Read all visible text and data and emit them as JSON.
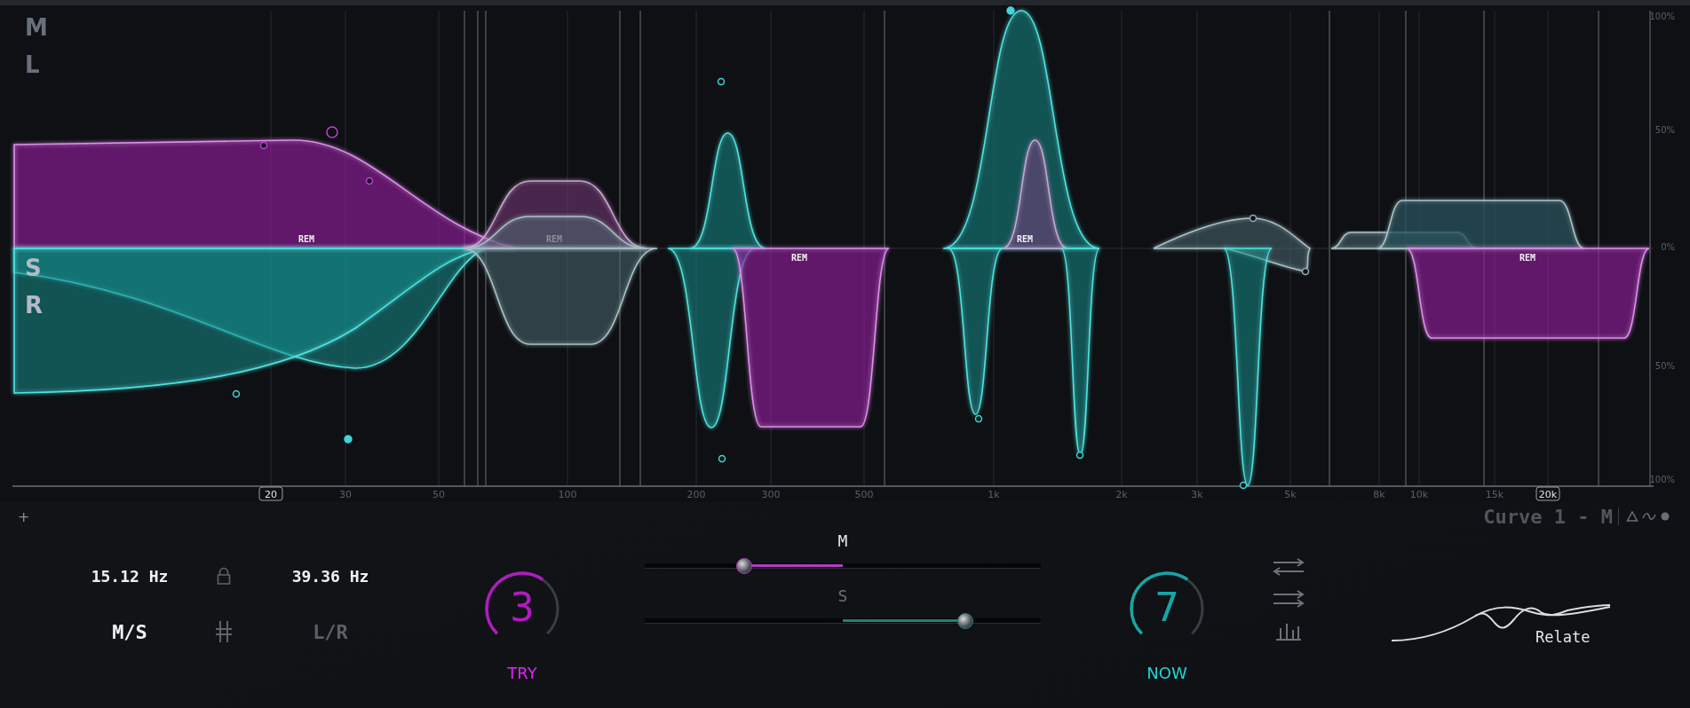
{
  "channel_labels": {
    "top": [
      "M",
      "L"
    ],
    "bottom": [
      "S",
      "R"
    ]
  },
  "band_labels": [
    {
      "text": "REM",
      "dimmed": false
    },
    {
      "text": "REM",
      "dimmed": true
    },
    {
      "text": "REM",
      "dimmed": false
    },
    {
      "text": "REM",
      "dimmed": false
    },
    {
      "text": "REM",
      "dimmed": false
    }
  ],
  "level_axis": [
    "100%",
    "50%",
    "0%",
    "50%",
    "100%"
  ],
  "frequency_axis": [
    {
      "text": "20",
      "boxed": true
    },
    {
      "text": "30",
      "boxed": false
    },
    {
      "text": "50",
      "boxed": false
    },
    {
      "text": "100",
      "boxed": false
    },
    {
      "text": "200",
      "boxed": false
    },
    {
      "text": "300",
      "boxed": false
    },
    {
      "text": "500",
      "boxed": false
    },
    {
      "text": "1k",
      "boxed": false
    },
    {
      "text": "2k",
      "boxed": false
    },
    {
      "text": "3k",
      "boxed": false
    },
    {
      "text": "5k",
      "boxed": false
    },
    {
      "text": "8k",
      "boxed": false
    },
    {
      "text": "10k",
      "boxed": false
    },
    {
      "text": "15k",
      "boxed": false
    },
    {
      "text": "20k",
      "boxed": true
    }
  ],
  "add_button": "+",
  "curve_name": "Curve 1 - M",
  "range": {
    "low": "15.12 Hz",
    "high": "39.36 Hz"
  },
  "modes": [
    {
      "label": "M/S",
      "selected": true
    },
    {
      "label": "L/R",
      "selected": false
    }
  ],
  "knobs": [
    {
      "value": "3",
      "label": "TRY",
      "level": 0.63,
      "color": "#b01cc0"
    },
    {
      "value": "7",
      "label": "NOW",
      "level": 0.63,
      "color": "#16a6a6"
    }
  ],
  "sliders": [
    {
      "label": "M",
      "level": 0.25,
      "color": "#b43cc4"
    },
    {
      "label": "S",
      "level": 0.81,
      "color": "#1f8080"
    }
  ],
  "relate": {
    "label": "Relate"
  }
}
